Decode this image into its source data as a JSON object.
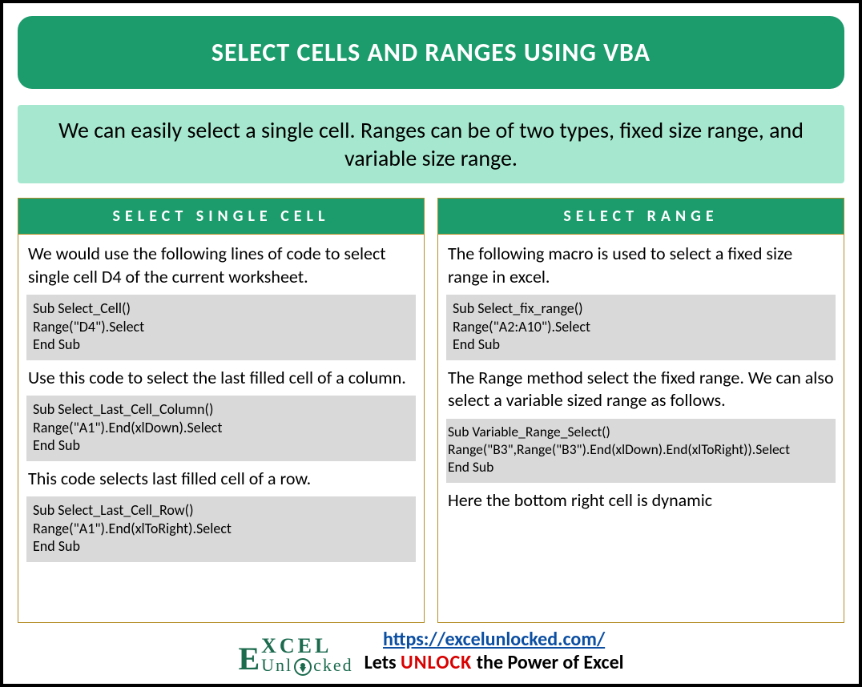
{
  "title": "SELECT CELLS AND RANGES USING VBA",
  "subtitle": "We can easily select a single cell. Ranges can be of two types, fixed size range, and variable size range.",
  "left": {
    "header": "SELECT SINGLE CELL",
    "p1": "We would use the following lines of code to select single cell D4 of the current worksheet.",
    "code1": "Sub Select_Cell()\nRange(\"D4\").Select\nEnd Sub",
    "p2": "Use this code to select the last filled cell of a column.",
    "code2": "Sub Select_Last_Cell_Column()\nRange(\"A1\").End(xlDown).Select\nEnd Sub",
    "p3": "This code selects last filled cell of a row.",
    "code3": "Sub Select_Last_Cell_Row()\nRange(\"A1\").End(xlToRight).Select\nEnd Sub"
  },
  "right": {
    "header": "SELECT RANGE",
    "p1": "The following macro is used to select a fixed size range in excel.",
    "code1": "Sub Select_fix_range()\nRange(\"A2:A10\").Select\nEnd Sub",
    "p2": "The Range method select the fixed range. We can also select a variable sized range as follows.",
    "code2": "Sub Variable_Range_Select()\nRange(\"B3\",Range(\"B3\").End(xlDown).End(xlToRight)).Select\nEnd Sub",
    "p3": "Here the bottom right cell is dynamic"
  },
  "footer": {
    "logo_top": "XCEL",
    "logo_big": "E",
    "logo_bottom_pre": "Unl",
    "logo_bottom_post": "cked",
    "url": "https://excelunlocked.com/",
    "tagline_pre": "Lets ",
    "tagline_unlock": "UNLOCK",
    "tagline_post": " the Power of Excel"
  }
}
